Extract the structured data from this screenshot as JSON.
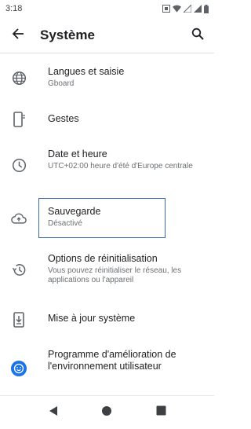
{
  "status_bar": {
    "time": "3:18",
    "icons": [
      "sim-status-icon",
      "wifi-icon",
      "cellular-signal-icon",
      "cellular-signal-icon",
      "battery-icon"
    ]
  },
  "app_bar": {
    "title": "Système",
    "back_icon": "arrow-back-icon",
    "search_icon": "search-icon"
  },
  "settings": {
    "items": [
      {
        "title": "Langues et saisie",
        "subtitle": "Gboard",
        "icon": "globe-icon"
      },
      {
        "title": "Gestes",
        "subtitle": "",
        "icon": "phone-gesture-icon"
      },
      {
        "title": "Date et heure",
        "subtitle": "UTC+02:00 heure d'été d'Europe centrale",
        "icon": "clock-icon"
      },
      {
        "title": "Sauvegarde",
        "subtitle": "Désactivé",
        "icon": "cloud-upload-icon"
      },
      {
        "title": "Options de réinitialisation",
        "subtitle": "Vous pouvez réinitialiser le réseau, les applications ou l'appareil",
        "icon": "history-icon"
      },
      {
        "title": "Mise à jour système",
        "subtitle": "",
        "icon": "system-update-icon"
      },
      {
        "title": "Programme d'amélioration de l'environnement utilisateur",
        "subtitle": "",
        "icon": "smiley-badge-icon"
      }
    ]
  },
  "nav_bar": {
    "back": "nav-back-icon",
    "home": "nav-home-icon",
    "recents": "nav-recents-icon"
  },
  "colors": {
    "accent": "#1a73e8",
    "highlight_border": "#3a6aa8",
    "icon_gray": "#5f6368",
    "text_primary": "#202124",
    "text_secondary": "#6b6f73"
  }
}
